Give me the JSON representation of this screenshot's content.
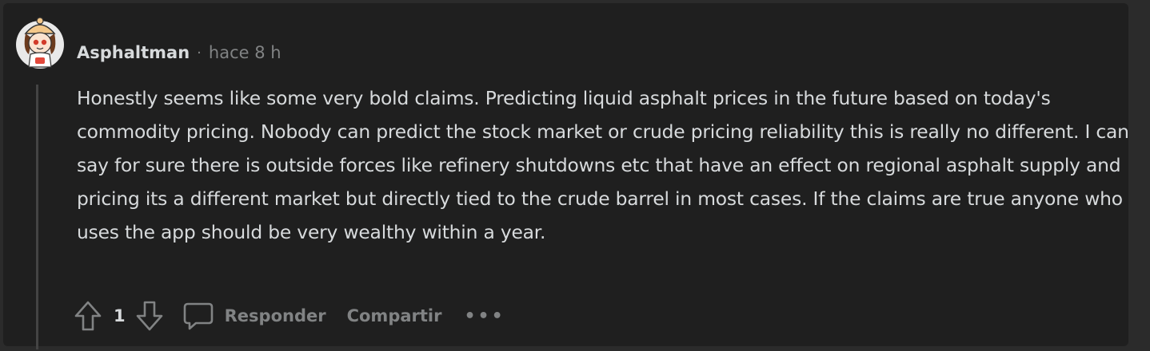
{
  "comment": {
    "author": "Asphaltman",
    "separator": "·",
    "time": "hace 8 h",
    "body": "Honestly seems like some very bold claims. Predicting liquid asphalt prices in the future based on today's commodity pricing. Nobody can predict the stock market or crude pricing reliability this is really no different. I can say for sure there is outside forces like refinery shutdowns etc that have an effect on regional asphalt supply and pricing its a different market but directly tied to the crude barrel in most cases. If the claims are true anyone who uses the app should be very wealthy within a year.",
    "score": "1"
  },
  "actions": {
    "reply_label": "Responder",
    "share_label": "Compartir",
    "more_label": "•••"
  },
  "icons": {
    "upvote": "arrow-up-icon",
    "downvote": "arrow-down-icon",
    "reply": "chat-bubble-icon",
    "more": "overflow-menu-icon"
  },
  "colors": {
    "background": "#2b2b2b",
    "card": "#1f1f1f",
    "text": "#d7dadc",
    "muted": "#818384"
  }
}
